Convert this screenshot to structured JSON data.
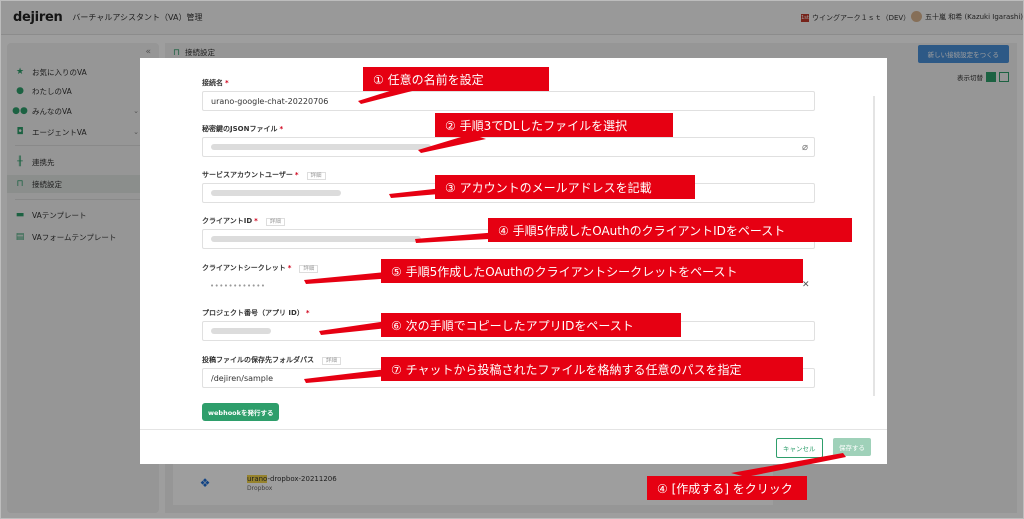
{
  "header": {
    "logo": "dejiren",
    "title": "バーチャルアシスタント（VA）管理",
    "tenant": "ウイングアーク１ｓｔ（DEV）",
    "tenant_icon": "1st",
    "user": "五十嵐 和希 (Kazuki Igarashi)"
  },
  "sidebar": {
    "collapse": "«",
    "items": [
      {
        "label": "お気に入りのVA",
        "icon": "star-icon"
      },
      {
        "label": "わたしのVA",
        "icon": "person-icon"
      },
      {
        "label": "みんなのVA",
        "icon": "people-icon"
      },
      {
        "label": "エージェントVA",
        "icon": "robot-icon"
      },
      {
        "label": "連携先",
        "icon": "connection-icon"
      },
      {
        "label": "接続設定",
        "icon": "plug-icon"
      },
      {
        "label": "VAテンプレート",
        "icon": "template-icon"
      },
      {
        "label": "VAフォームテンプレート",
        "icon": "form-template-icon"
      }
    ]
  },
  "main": {
    "title": "接続設定",
    "new_button": "新しい接続設定をつくる",
    "view_toggle_label": "表示切替",
    "card": {
      "name_highlight": "urano",
      "name_rest": "-dropbox-20211206",
      "subtitle": "Dropbox"
    }
  },
  "modal": {
    "fields": {
      "name": {
        "label": "接続名",
        "required": "*",
        "value": "urano-google-chat-20220706"
      },
      "json_key": {
        "label": "秘密鍵のJSONファイル",
        "required": "*"
      },
      "service_account": {
        "label": "サービスアカウントユーザー",
        "required": "*",
        "detail": "詳細"
      },
      "client_id": {
        "label": "クライアントID",
        "required": "*",
        "detail": "詳細"
      },
      "client_secret": {
        "label": "クライアントシークレット",
        "required": "*",
        "detail": "詳細",
        "value": "••••••••••••"
      },
      "project_number": {
        "label": "プロジェクト番号（アプリ ID）",
        "required": "*"
      },
      "folder_path": {
        "label": "投稿ファイルの保存先フォルダパス",
        "detail": "詳細",
        "value": "/dejiren/sample"
      }
    },
    "webhook_button": "webhookを発行する",
    "cancel_button": "キャンセル",
    "save_button": "保存する"
  },
  "callouts": {
    "c1": "① 任意の名前を設定",
    "c2": "② 手順3でDLしたファイルを選択",
    "c3": "③ アカウントのメールアドレスを記載",
    "c4": "④ 手順5作成したOAuthのクライアントIDをペースト",
    "c5": "⑤ 手順5作成したOAuthのクライアントシークレットをペースト",
    "c6": "⑥ 次の手順でコピーしたアプリIDをペースト",
    "c7": "⑦ チャットから投稿されたファイルを格納する任意のパスを指定",
    "c8": "④ [作成する] をクリック"
  },
  "colors": {
    "accent": "#2e9e6b",
    "callout": "#e60012",
    "primary_button": "#4a90d9"
  }
}
